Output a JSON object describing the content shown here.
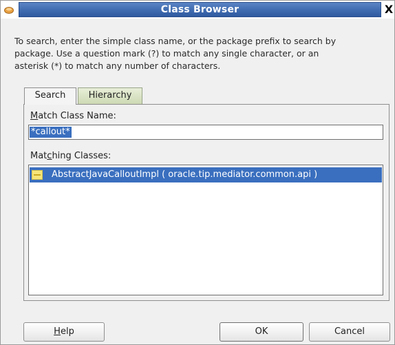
{
  "window": {
    "title": "Class Browser",
    "close_label": "X"
  },
  "instructions": "To search, enter the simple class name, or the package prefix to search by\npackage. Use a question mark (?) to match any single character, or an\nasterisk (*) to match any number of characters.",
  "tabs": [
    {
      "label": "Search",
      "selected": true
    },
    {
      "label": "Hierarchy",
      "selected": false
    }
  ],
  "search_tab": {
    "match_label_prefix": "",
    "match_label_mnemonic": "M",
    "match_label_rest": "atch Class Name:",
    "match_value": "*callout*",
    "matching_label_prefix": "Mat",
    "matching_label_mnemonic": "c",
    "matching_label_rest": "hing Classes:",
    "results": [
      {
        "text": "AbstractJavaCalloutImpl ( oracle.tip.mediator.common.api )",
        "icon": "class-icon",
        "selected": true
      }
    ]
  },
  "buttons": {
    "help_mnemonic": "H",
    "help_rest": "elp",
    "ok": "OK",
    "cancel": "Cancel"
  }
}
